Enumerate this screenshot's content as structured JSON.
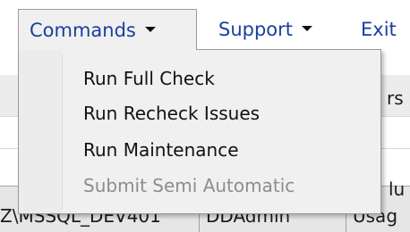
{
  "menubar": {
    "items": [
      {
        "label": "Commands",
        "has_caret": true,
        "state": "open"
      },
      {
        "label": "Support",
        "has_caret": true
      },
      {
        "label": "Exit",
        "has_caret": false
      }
    ]
  },
  "dropdown": {
    "items": [
      {
        "label": "Run Full Check",
        "enabled": true
      },
      {
        "label": "Run Recheck Issues",
        "enabled": true
      },
      {
        "label": "Run Maintenance",
        "enabled": true
      },
      {
        "label": "Submit Semi Automatic",
        "enabled": false
      }
    ]
  },
  "background_grid": {
    "header_fragment_1": "rs",
    "header_fragment_2": "lu",
    "row_cells": [
      "Z\\MSSQL_DEV401",
      "DDAdmin",
      "Usag"
    ]
  },
  "colors": {
    "menu_link": "#1a3fa0",
    "menu_bg": "#f0f0f0",
    "disabled_text": "#8d8d8d"
  }
}
